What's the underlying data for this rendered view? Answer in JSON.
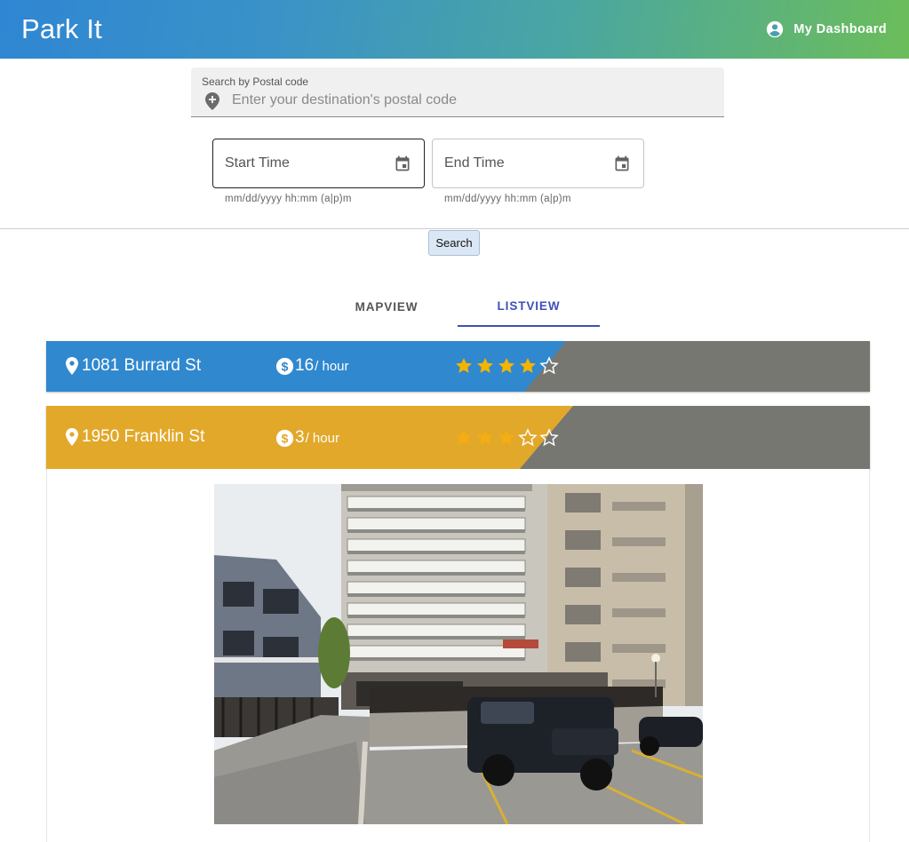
{
  "header": {
    "title": "Park It",
    "dashboard_label": "My Dashboard"
  },
  "search": {
    "label": "Search by Postal code",
    "placeholder": "Enter your destination's postal code",
    "value": ""
  },
  "start_time": {
    "label": "Start Time",
    "helper": "mm/dd/yyyy hh:mm (a|p)m"
  },
  "end_time": {
    "label": "End Time",
    "helper": "mm/dd/yyyy hh:mm (a|p)m"
  },
  "search_button": "Search",
  "tabs": [
    {
      "label": "MAPVIEW",
      "active": false
    },
    {
      "label": "LISTVIEW",
      "active": true
    }
  ],
  "listings": [
    {
      "address": "1081 Burrard St",
      "price": "16",
      "unit": "/ hour",
      "rating": 4,
      "max_rating": 5,
      "color": "#3088cf",
      "star_color": "#f5b400"
    },
    {
      "address": "1950 Franklin St",
      "price": "3",
      "unit": "/ hour",
      "rating": 3,
      "max_rating": 5,
      "color": "#e2a82a",
      "star_color": "#f4ad12"
    }
  ],
  "colors": {
    "appbar_gradient": [
      "#2f86d2",
      "#6cbd5a"
    ],
    "listing_dark": "#767771",
    "tab_active": "#3f51b5"
  },
  "icons": {
    "dashboard": "account-circle-icon",
    "search": "add-location-icon",
    "date": "calendar-icon",
    "address": "location-pin-icon",
    "price": "dollar-circle-icon",
    "rating": "star-icon"
  }
}
